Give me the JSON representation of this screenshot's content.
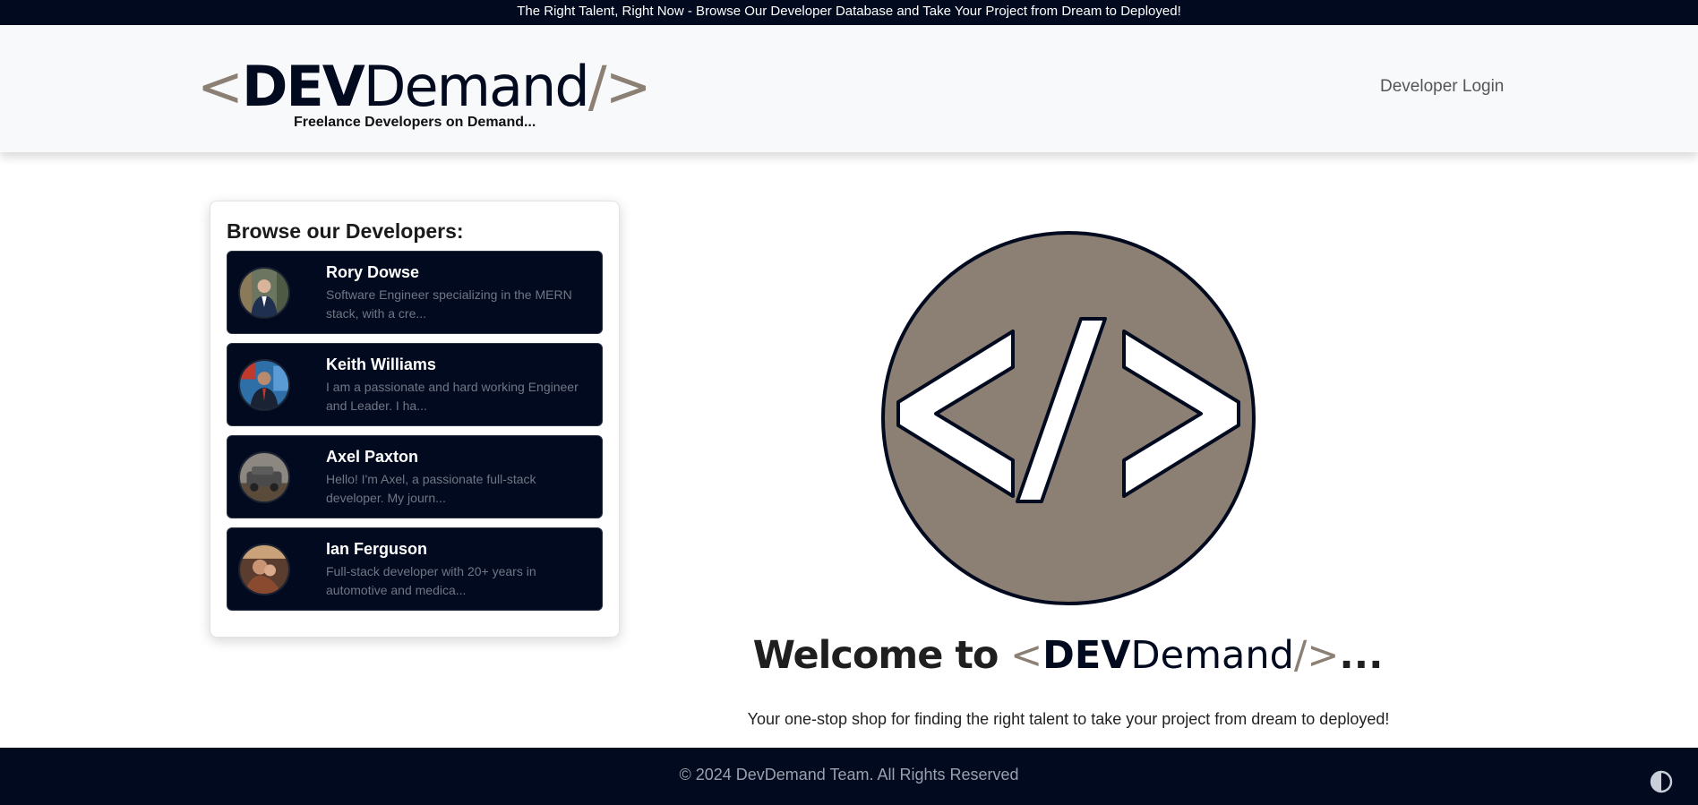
{
  "announcement": "The Right Talent, Right Now - Browse Our Developer Database and Take Your Project from Dream to Deployed!",
  "brand": {
    "open_bracket": "<",
    "dev": "DEV",
    "demand": "Demand",
    "close_bracket": "/>",
    "tagline": "Freelance Developers on Demand..."
  },
  "nav": {
    "login": "Developer Login"
  },
  "developers": {
    "heading": "Browse our Developers:",
    "items": [
      {
        "name": "Rory Dowse",
        "description": "Software Engineer specializing in the MERN stack, with a cre..."
      },
      {
        "name": "Keith Williams",
        "description": "I am a passionate and hard working Engineer and Leader. I ha..."
      },
      {
        "name": "Axel Paxton",
        "description": "Hello! I'm Axel, a passionate full-stack developer. My journ..."
      },
      {
        "name": "Ian Ferguson",
        "description": "Full-stack developer with 20+ years in automotive and medica..."
      }
    ]
  },
  "hero": {
    "welcome": "Welcome to",
    "dots": "...",
    "subtitle": "Your one-stop shop for finding the right talent to take your project from dream to deployed!"
  },
  "footer": {
    "copyright": "© 2024 DevDemand Team. All Rights Reserved"
  },
  "colors": {
    "navy": "#020a1f",
    "taupe": "#8c7f74",
    "navbar_bg": "#f8f9fb"
  },
  "icons": {
    "theme_toggle": "half-circle-contrast-icon",
    "hero_logo": "code-brackets-circle-icon"
  }
}
